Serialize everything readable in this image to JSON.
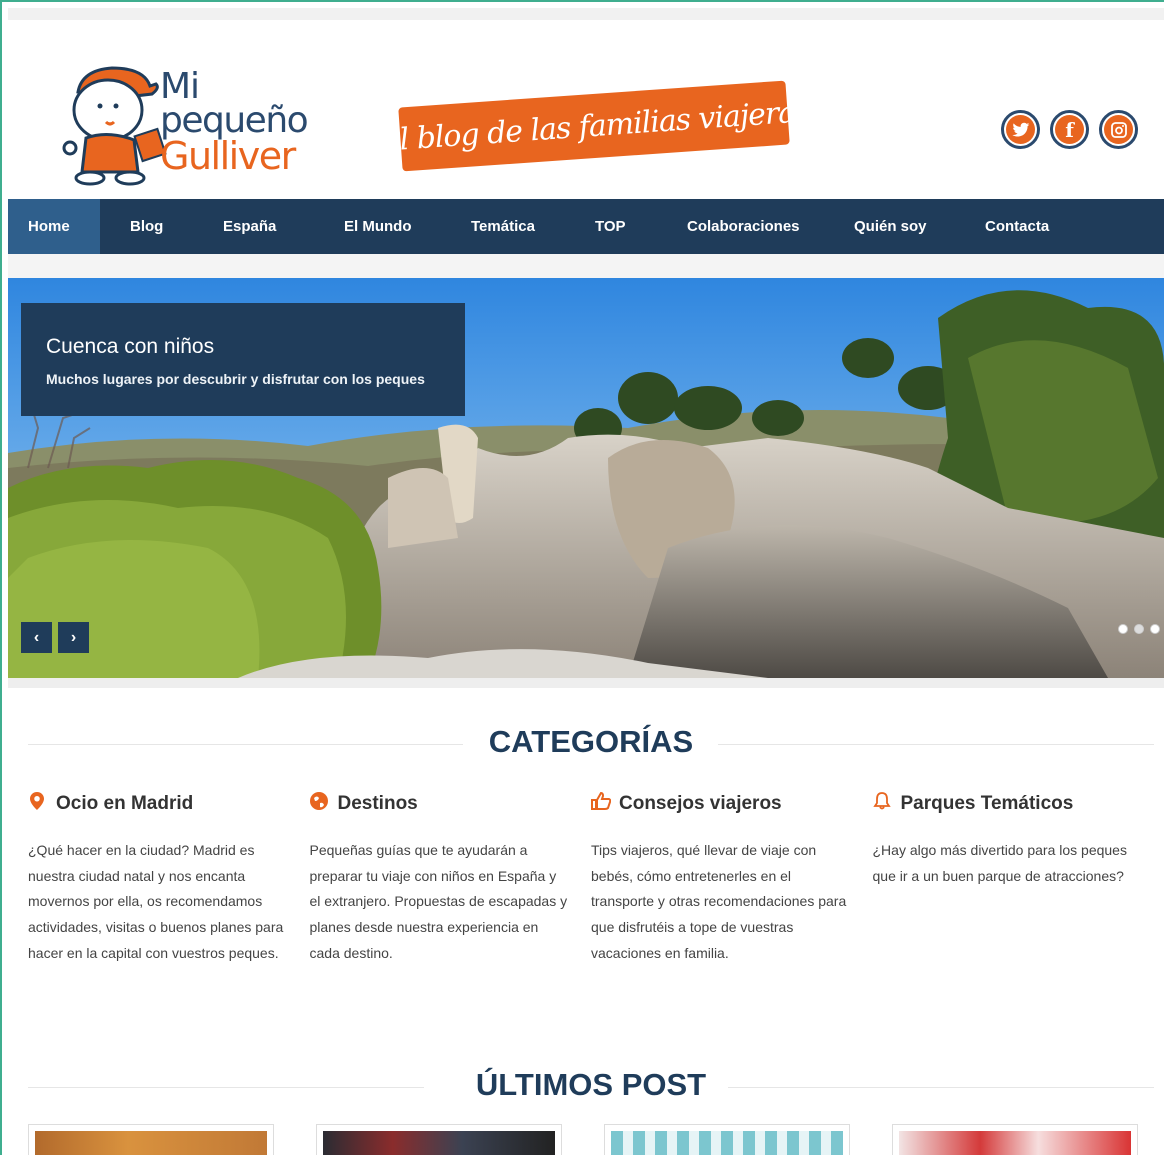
{
  "header": {
    "logo_lines": [
      "Mi",
      "pequeño",
      "Gulliver"
    ],
    "tagline": "El blog de las familias viajeras",
    "social": [
      {
        "name": "twitter-icon",
        "glyph": "t"
      },
      {
        "name": "facebook-icon",
        "glyph": "f"
      },
      {
        "name": "instagram-icon",
        "glyph": "◎"
      }
    ]
  },
  "nav": {
    "items": [
      {
        "label": "Home",
        "active": true
      },
      {
        "label": "Blog"
      },
      {
        "label": "España"
      },
      {
        "label": "El Mundo"
      },
      {
        "label": "Temática"
      },
      {
        "label": "TOP"
      },
      {
        "label": "Colaboraciones"
      },
      {
        "label": "Quién soy"
      },
      {
        "label": "Contacta"
      }
    ]
  },
  "slider": {
    "title": "Cuenca con niños",
    "subtitle": "Muchos lugares por descubrir y disfrutar con los peques",
    "prev": "‹",
    "next": "›",
    "slide_count": 3,
    "current_slide": 2
  },
  "categories": {
    "heading": "CATEGORÍAS",
    "items": [
      {
        "icon": "map-pin-icon",
        "glyph": "⚲",
        "title": "Ocio en Madrid",
        "text": "¿Qué hacer en la ciudad? Madrid es nuestra ciudad natal y nos encanta movernos por ella, os recomendamos actividades, visitas o buenos planes para hacer en la capital con vuestros peques."
      },
      {
        "icon": "globe-icon",
        "glyph": "●",
        "title": "Destinos",
        "text": "Pequeñas guías que te ayudarán a preparar tu viaje con niños en España y el extranjero. Propuestas de escapadas y planes desde nuestra experiencia en cada destino."
      },
      {
        "icon": "thumbs-up-icon",
        "glyph": "👍",
        "title": "Consejos viajeros",
        "text": "Tips viajeros, qué llevar de viaje con bebés, cómo entretenerles en el transporte y otras recomendaciones para que disfrutéis a tope de vuestras vacaciones en familia."
      },
      {
        "icon": "bell-icon",
        "glyph": "🔔",
        "title": "Parques Temáticos",
        "text": "¿Hay algo más divertido para los peques que ir a un buen parque de atracciones?"
      }
    ]
  },
  "latest": {
    "heading": "ÚLTIMOS POST"
  },
  "colors": {
    "navy": "#1f3c5a",
    "orange": "#e8651f",
    "active_nav": "#2f5f8c"
  }
}
